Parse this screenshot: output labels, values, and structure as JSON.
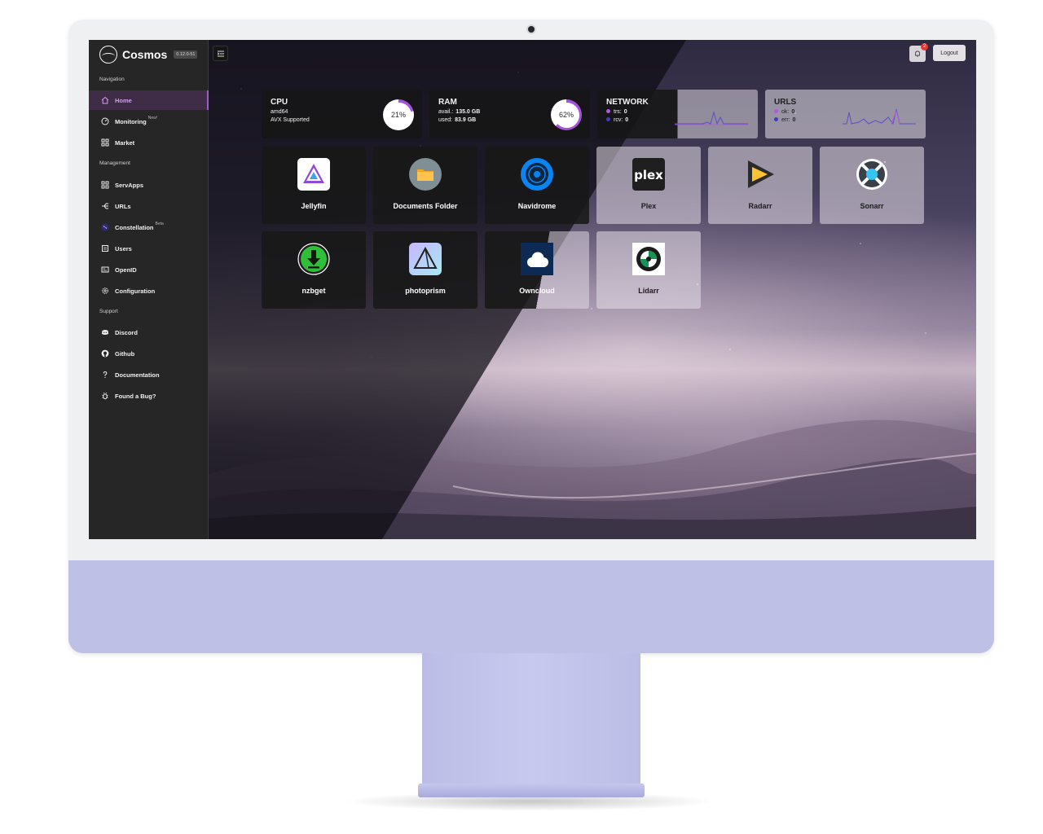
{
  "app": {
    "name": "Cosmos",
    "version": "0.12.0-51"
  },
  "sidebar": {
    "sections": [
      {
        "label": "Navigation"
      },
      {
        "label": "Management"
      },
      {
        "label": "Support"
      }
    ],
    "items": [
      {
        "label": "Home"
      },
      {
        "label": "Monitoring",
        "badge": "New!"
      },
      {
        "label": "Market"
      },
      {
        "label": "ServApps"
      },
      {
        "label": "URLs"
      },
      {
        "label": "Constellation",
        "badge": "Beta"
      },
      {
        "label": "Users"
      },
      {
        "label": "OpenID"
      },
      {
        "label": "Configuration"
      },
      {
        "label": "Discord"
      },
      {
        "label": "Github"
      },
      {
        "label": "Documentation"
      },
      {
        "label": "Found a Bug?"
      }
    ]
  },
  "topbar": {
    "notification_count": "2",
    "logout_label": "Logout"
  },
  "stats": {
    "cpu": {
      "title": "CPU",
      "arch": "amd64",
      "feature": "AVX Supported",
      "percent": "21%",
      "percent_value": 21
    },
    "ram": {
      "title": "RAM",
      "avail_label": "avail.:",
      "avail_value": "135.0 GB",
      "used_label": "used:",
      "used_value": "83.9 GB",
      "percent": "62%",
      "percent_value": 62
    },
    "network": {
      "title": "NETWORK",
      "trs_label": "trs:",
      "trs_value": "0",
      "rcv_label": "rcv:",
      "rcv_value": "0"
    },
    "urls": {
      "title": "URLS",
      "ok_label": "ok:",
      "ok_value": "0",
      "err_label": "err:",
      "err_value": "0"
    }
  },
  "apps": [
    {
      "name": "Jellyfin",
      "icon": "jellyfin-icon"
    },
    {
      "name": "Documents Folder",
      "icon": "folder-icon"
    },
    {
      "name": "Navidrome",
      "icon": "navidrome-icon"
    },
    {
      "name": "Plex",
      "icon": "plex-icon",
      "icon_text": "plex"
    },
    {
      "name": "Radarr",
      "icon": "radarr-icon"
    },
    {
      "name": "Sonarr",
      "icon": "sonarr-icon"
    },
    {
      "name": "nzbget",
      "icon": "nzbget-icon"
    },
    {
      "name": "photoprism",
      "icon": "photoprism-icon"
    },
    {
      "name": "Owncloud",
      "icon": "owncloud-icon"
    },
    {
      "name": "Lidarr",
      "icon": "lidarr-icon"
    }
  ],
  "colors": {
    "accent": "#a453d8",
    "sidebar_bg": "#262626",
    "active_item_bg": "#3f2d48",
    "series_purple": "#b25ad8",
    "series_blue": "#3d3fb8"
  }
}
